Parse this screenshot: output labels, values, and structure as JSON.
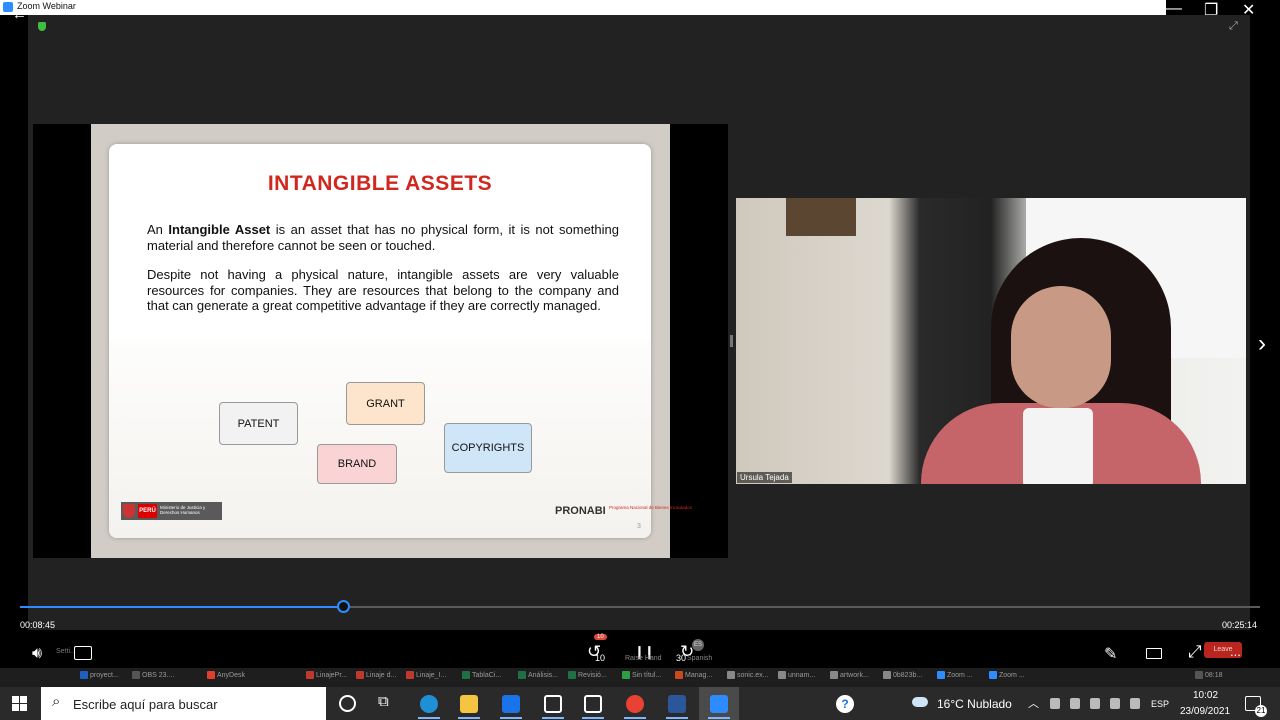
{
  "window": {
    "title": "Zoom Webinar",
    "controls": [
      "—",
      "❐",
      "✕"
    ]
  },
  "slide": {
    "title": "INTANGIBLE ASSETS",
    "para1_prefix": "An ",
    "para1_bold": "Intangible Asset",
    "para1_rest": " is an asset that has no physical form, it is not something material and therefore cannot be seen or touched.",
    "para2": "Despite not having a physical nature, intangible assets are very valuable resources for companies. They are resources that belong to the company and that can generate a great competitive advantage if they are correctly managed.",
    "boxes": {
      "patent": "PATENT",
      "grant": "GRANT",
      "brand": "BRAND",
      "copyrights": "COPYRIGHTS"
    },
    "logo_peru": "PERÚ",
    "logo_ministry": "Ministerio de Justicia y Derechos Humanos",
    "pronabi": "PRONABI",
    "pronabi_sub": "Programa Nacional de Bienes Incautados",
    "page_number": "3"
  },
  "video": {
    "participant_name": "Ursula Tejada"
  },
  "playback": {
    "current_time": "00:08:45",
    "total_time": "00:25:14",
    "progress_fraction": 0.2614
  },
  "controls": {
    "rewind_seconds": "10",
    "forward_seconds": "30",
    "rewind_badge": "10",
    "raise_hand": "Raise Hand",
    "spanish": "Spanish",
    "language_badge": "ES",
    "settings": "Setti...",
    "leave": "Leave",
    "more": "..."
  },
  "thumbs": [
    {
      "label": "proyect...",
      "color": "#1f5fbf"
    },
    {
      "label": "OBS 23....",
      "color": "#555555"
    },
    {
      "label": "AnyDesk",
      "color": "#e03e2d"
    },
    {
      "label": "LinajePr...",
      "color": "#c0392b"
    },
    {
      "label": "Linaje d...",
      "color": "#c0392b"
    },
    {
      "label": "Linaje_I...",
      "color": "#c0392b"
    },
    {
      "label": "TablaCi...",
      "color": "#1e7145"
    },
    {
      "label": "Análisis...",
      "color": "#1e7145"
    },
    {
      "label": "Revisió...",
      "color": "#1e7145"
    },
    {
      "label": "Sin títul...",
      "color": "#2c9f45"
    },
    {
      "label": "Manag...",
      "color": "#c94a1c"
    },
    {
      "label": "sonic.ex...",
      "color": "#888888"
    },
    {
      "label": "unnam...",
      "color": "#888888"
    },
    {
      "label": "artwork...",
      "color": "#888888"
    },
    {
      "label": "0b823b...",
      "color": "#888888"
    },
    {
      "label": "Zoom ...",
      "color": "#2d8cff"
    },
    {
      "label": "Zoom ...",
      "color": "#2d8cff"
    },
    {
      "label": "08:18",
      "color": "#555555"
    }
  ],
  "taskbar": {
    "search_placeholder": "Escribe aquí para buscar",
    "help": "?",
    "weather": "16°C  Nublado",
    "language": "ESP",
    "time": "10:02",
    "date": "23/09/2021",
    "notifications": "21",
    "apps": [
      {
        "name": "edge",
        "color": "#1f8fd6"
      },
      {
        "name": "file-explorer",
        "color": "#f5c542"
      },
      {
        "name": "mail",
        "color": "#1a73e8"
      },
      {
        "name": "dropbox",
        "color": "#2a2a2a"
      },
      {
        "name": "app-bolt",
        "color": "#2a2a2a"
      },
      {
        "name": "chrome",
        "color": "#e94235"
      },
      {
        "name": "word",
        "color": "#2b579a"
      },
      {
        "name": "zoom",
        "color": "#2d8cff"
      }
    ]
  },
  "accent_color": "#2d8cff"
}
